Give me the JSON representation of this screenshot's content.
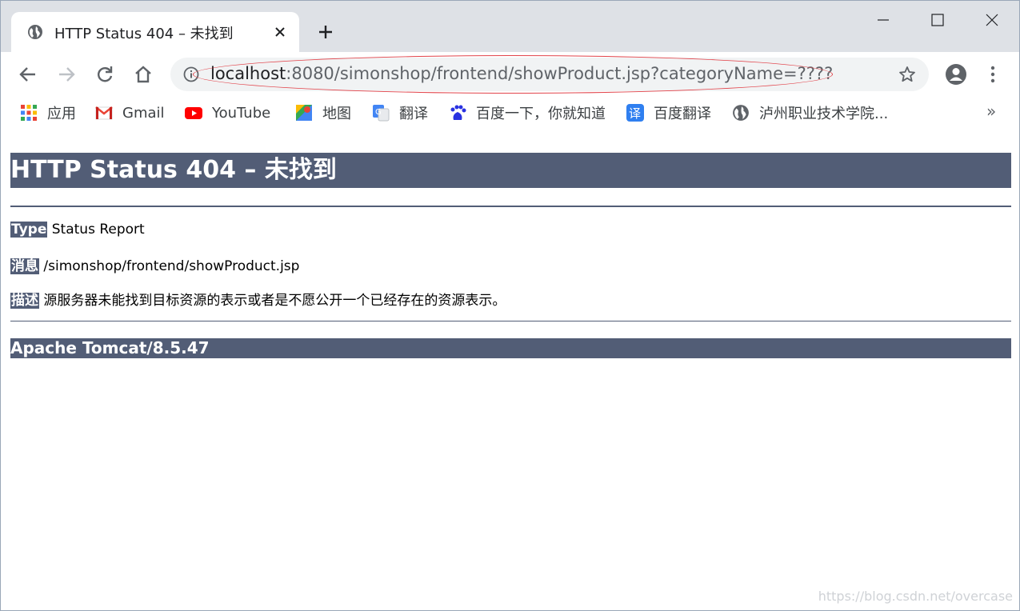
{
  "tab": {
    "title": "HTTP Status 404 – 未找到"
  },
  "omnibox": {
    "host": "localhost",
    "rest": ":8080/simonshop/frontend/showProduct.jsp?categoryName=????"
  },
  "bookmarks": [
    {
      "label": "应用",
      "icon": "apps-grid-icon"
    },
    {
      "label": "Gmail",
      "icon": "gmail-icon"
    },
    {
      "label": "YouTube",
      "icon": "youtube-icon"
    },
    {
      "label": "地图",
      "icon": "maps-icon"
    },
    {
      "label": "翻译",
      "icon": "translate-icon"
    },
    {
      "label": "百度一下，你就知道",
      "icon": "baidu-icon"
    },
    {
      "label": "百度翻译",
      "icon": "baidu-translate-icon"
    },
    {
      "label": "泸州职业技术学院...",
      "icon": "globe-icon"
    }
  ],
  "bookmarks_more": "»",
  "page": {
    "heading": "HTTP Status 404 – 未找到",
    "type_key": "Type",
    "type_val": "Status Report",
    "msg_key": "消息",
    "msg_val": "/simonshop/frontend/showProduct.jsp",
    "desc_key": "描述",
    "desc_val": "源服务器未能找到目标资源的表示或者是不愿公开一个已经存在的资源表示。",
    "footer": "Apache Tomcat/8.5.47"
  },
  "watermark": "https://blog.csdn.net/overcase",
  "colors": {
    "tomcat_accent": "#525d76",
    "annotation": "#e2444b"
  }
}
